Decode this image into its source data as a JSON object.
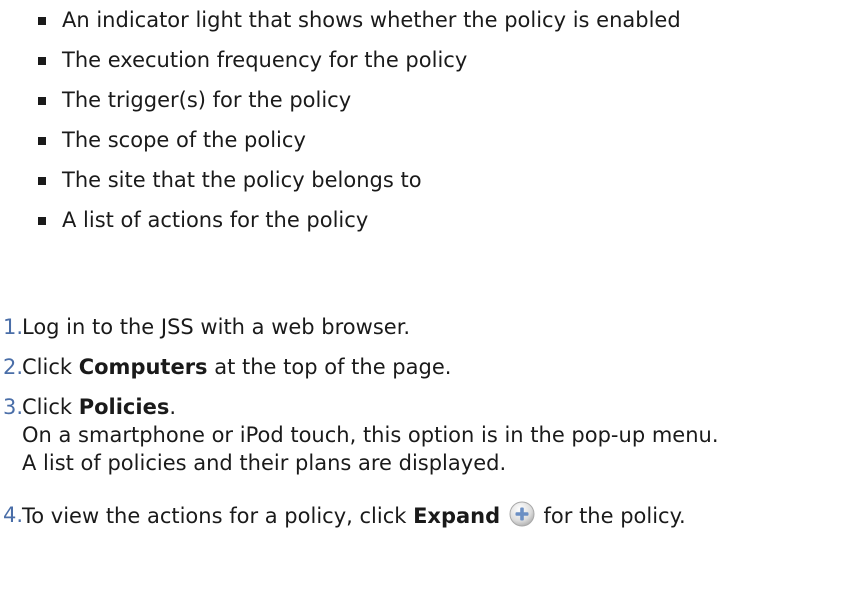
{
  "bullets": [
    "An indicator light that shows whether the policy is enabled",
    "The execution frequency for the policy",
    "The trigger(s) for the policy",
    "The scope of the policy",
    "The site that the policy belongs to",
    "A list of actions for the policy"
  ],
  "steps": [
    {
      "num": "1.",
      "text": "Log in to the JSS with a web browser."
    },
    {
      "num": "2.",
      "pre": "Click ",
      "bold": "Computers",
      "post": " at the top of the page."
    },
    {
      "num": "3.",
      "pre": "Click ",
      "bold": "Policies",
      "post": ".",
      "extra": [
        "On a smartphone or iPod touch, this option is in the pop-up menu.",
        "A list of policies and their plans are displayed."
      ]
    },
    {
      "num": "4.",
      "pre": "To view the actions for a policy, click ",
      "bold": "Expand",
      "post": " for the policy."
    }
  ],
  "icons": {
    "expand": "plus-circle-icon"
  },
  "colors": {
    "step_number": "#4a6ea8",
    "text": "#1a1a1a"
  }
}
